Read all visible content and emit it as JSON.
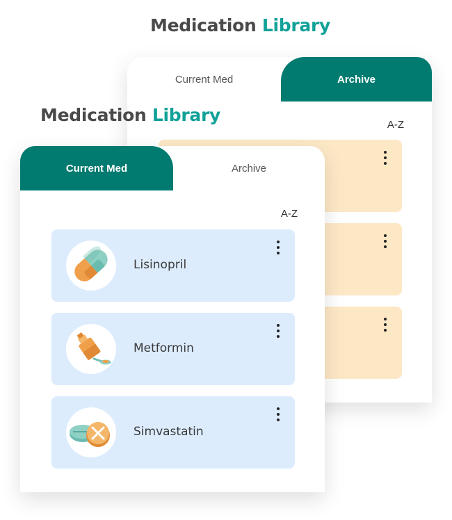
{
  "back_view": {
    "title": {
      "text": "Medication",
      "accent": "Library"
    },
    "tabs": [
      {
        "label": "Current Med",
        "active": false
      },
      {
        "label": "Archive",
        "active": true
      }
    ],
    "sort_label": "A-Z",
    "item_count_visible": 3,
    "item_color": "#fde8c6"
  },
  "front_view": {
    "title": {
      "text": "Medication",
      "accent": "Library"
    },
    "tabs": [
      {
        "label": "Current Med",
        "active": true
      },
      {
        "label": "Archive",
        "active": false
      }
    ],
    "sort_label": "A-Z",
    "item_color": "#dcecfd",
    "medications": [
      {
        "name": "Lisinopril",
        "icon": "capsule-icon"
      },
      {
        "name": "Metformin",
        "icon": "syrup-bottle-icon"
      },
      {
        "name": "Simvastatin",
        "icon": "tablets-icon"
      }
    ]
  },
  "colors": {
    "primary": "#017a70",
    "accent_text": "#12a198",
    "title_text": "#4a4a4a"
  }
}
